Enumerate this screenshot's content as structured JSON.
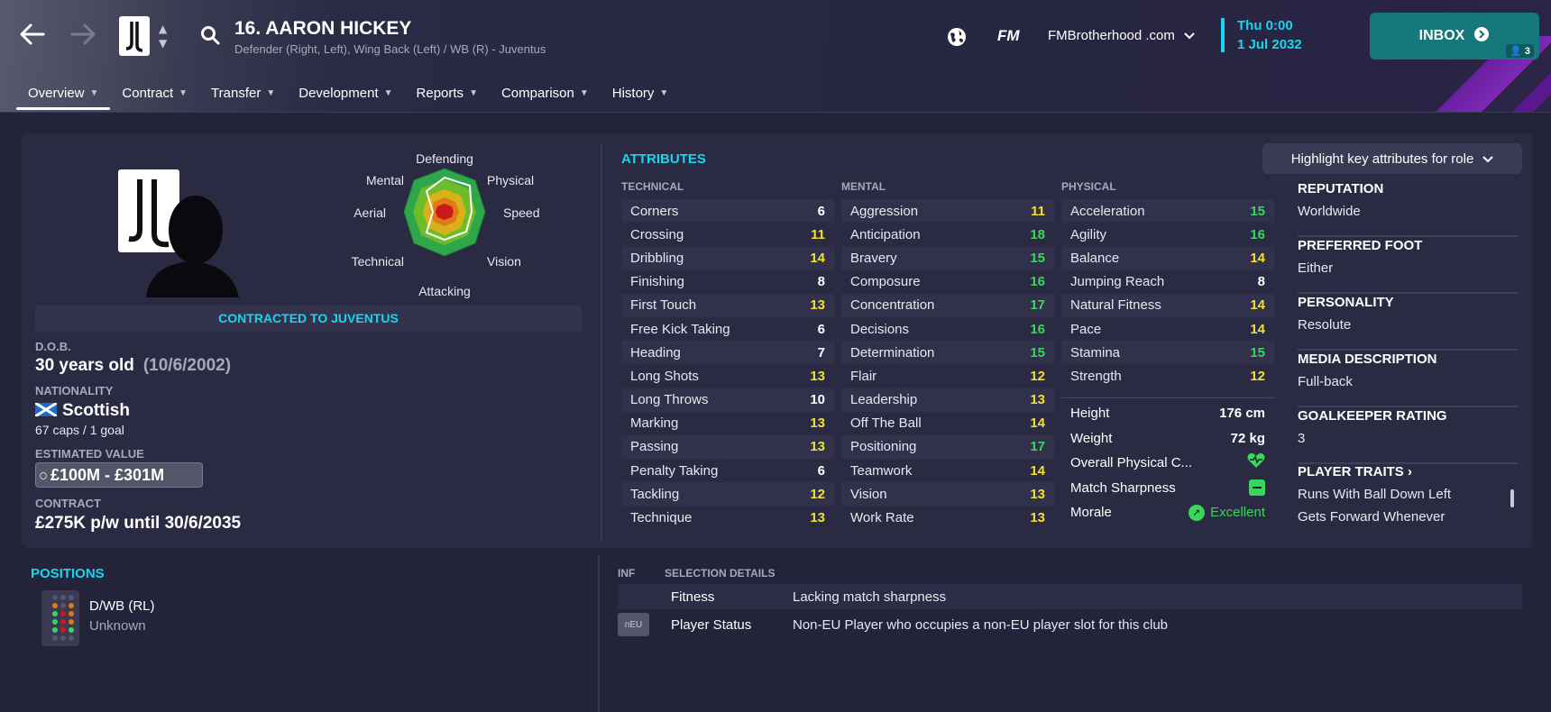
{
  "header": {
    "player_title": "16. AARON HICKEY",
    "player_subtitle": "Defender (Right, Left), Wing Back (Left) / WB (R) - Juventus",
    "fm_logo": "FM",
    "site": "FMBrotherhood .com",
    "date_day": "Thu 0:00",
    "date_full": "1 Jul 2032",
    "inbox_label": "INBOX",
    "inbox_count": "3"
  },
  "tabs": [
    {
      "label": "Overview"
    },
    {
      "label": "Contract"
    },
    {
      "label": "Transfer"
    },
    {
      "label": "Development"
    },
    {
      "label": "Reports"
    },
    {
      "label": "Comparison"
    },
    {
      "label": "History"
    }
  ],
  "profile": {
    "contracted": "CONTRACTED TO JUVENTUS",
    "dob_label": "D.O.B.",
    "age": "30 years old",
    "dob": "(10/6/2002)",
    "nationality_label": "NATIONALITY",
    "nationality": "Scottish",
    "caps": "67 caps / 1 goal",
    "value_label": "ESTIMATED VALUE",
    "value": "£100M - £301M",
    "contract_label": "CONTRACT",
    "contract": "£275K p/w until 30/6/2035"
  },
  "spider": {
    "labels": {
      "defending": "Defending",
      "physical": "Physical",
      "speed": "Speed",
      "vision": "Vision",
      "attacking": "Attacking",
      "technical": "Technical",
      "aerial": "Aerial",
      "mental": "Mental"
    }
  },
  "attributes": {
    "title": "ATTRIBUTES",
    "highlight_button": "Highlight key attributes for role",
    "technical_header": "TECHNICAL",
    "mental_header": "MENTAL",
    "physical_header": "PHYSICAL",
    "technical": [
      {
        "name": "Corners",
        "value": "6"
      },
      {
        "name": "Crossing",
        "value": "11"
      },
      {
        "name": "Dribbling",
        "value": "14"
      },
      {
        "name": "Finishing",
        "value": "8"
      },
      {
        "name": "First Touch",
        "value": "13"
      },
      {
        "name": "Free Kick Taking",
        "value": "6"
      },
      {
        "name": "Heading",
        "value": "7"
      },
      {
        "name": "Long Shots",
        "value": "13"
      },
      {
        "name": "Long Throws",
        "value": "10"
      },
      {
        "name": "Marking",
        "value": "13"
      },
      {
        "name": "Passing",
        "value": "13"
      },
      {
        "name": "Penalty Taking",
        "value": "6"
      },
      {
        "name": "Tackling",
        "value": "12"
      },
      {
        "name": "Technique",
        "value": "13"
      }
    ],
    "mental": [
      {
        "name": "Aggression",
        "value": "11"
      },
      {
        "name": "Anticipation",
        "value": "18"
      },
      {
        "name": "Bravery",
        "value": "15"
      },
      {
        "name": "Composure",
        "value": "16"
      },
      {
        "name": "Concentration",
        "value": "17"
      },
      {
        "name": "Decisions",
        "value": "16"
      },
      {
        "name": "Determination",
        "value": "15"
      },
      {
        "name": "Flair",
        "value": "12"
      },
      {
        "name": "Leadership",
        "value": "13"
      },
      {
        "name": "Off The Ball",
        "value": "14"
      },
      {
        "name": "Positioning",
        "value": "17"
      },
      {
        "name": "Teamwork",
        "value": "14"
      },
      {
        "name": "Vision",
        "value": "13"
      },
      {
        "name": "Work Rate",
        "value": "13"
      }
    ],
    "physical": [
      {
        "name": "Acceleration",
        "value": "15"
      },
      {
        "name": "Agility",
        "value": "16"
      },
      {
        "name": "Balance",
        "value": "14"
      },
      {
        "name": "Jumping Reach",
        "value": "8"
      },
      {
        "name": "Natural Fitness",
        "value": "14"
      },
      {
        "name": "Pace",
        "value": "14"
      },
      {
        "name": "Stamina",
        "value": "15"
      },
      {
        "name": "Strength",
        "value": "12"
      }
    ],
    "physical_extra": {
      "height_label": "Height",
      "height": "176 cm",
      "weight_label": "Weight",
      "weight": "72 kg",
      "overall_label": "Overall Physical C...",
      "sharpness_label": "Match Sharpness",
      "morale_label": "Morale",
      "morale": "Excellent"
    }
  },
  "side_info": [
    {
      "label": "REPUTATION",
      "value": "Worldwide"
    },
    {
      "label": "PREFERRED FOOT",
      "value": "Either"
    },
    {
      "label": "PERSONALITY",
      "value": "Resolute"
    },
    {
      "label": "MEDIA DESCRIPTION",
      "value": "Full-back"
    },
    {
      "label": "GOALKEEPER RATING",
      "value": "3"
    }
  ],
  "traits": {
    "label": "PLAYER TRAITS",
    "items": [
      "Runs With Ball Down Left",
      "Gets Forward Whenever"
    ]
  },
  "positions": {
    "title": "POSITIONS",
    "name": "D/WB (RL)",
    "level": "Unknown"
  },
  "selection": {
    "inf_header": "INF",
    "title": "SELECTION DETAILS",
    "rows": [
      {
        "label": "Fitness",
        "value": "Lacking match sharpness"
      },
      {
        "badge": "nEU",
        "label": "Player Status",
        "value": "Non-EU Player who occupies a non-EU player slot for this club"
      }
    ]
  },
  "colors": {
    "accent": "#19d6f0",
    "rating_high": "#36d85a",
    "rating_mid": "#f2e22e",
    "inbox": "#16787c"
  }
}
